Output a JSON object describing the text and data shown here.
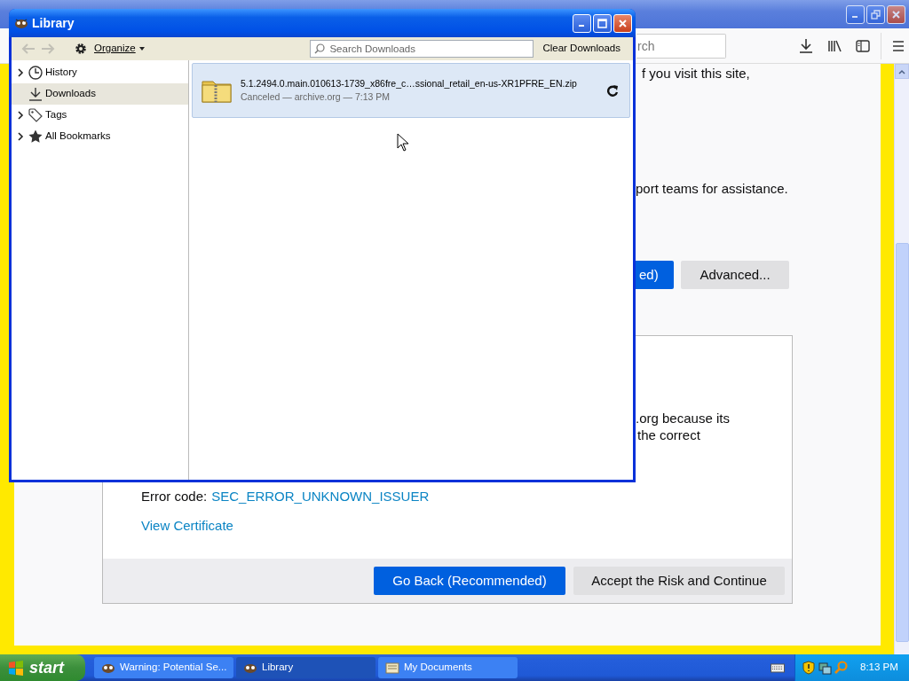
{
  "browser": {
    "search_placeholder": "rch",
    "page": {
      "intro_fragment": "f you visit this site,",
      "support_fragment": "port teams for assistance.",
      "buttons": [
        {
          "label": "ed)",
          "kind": "primary"
        },
        {
          "label": "Advanced...",
          "kind": "secondary"
        }
      ],
      "details_lines": [
        ".org because its",
        "the correct"
      ],
      "error_label": "Error code:",
      "error_code": "SEC_ERROR_UNKNOWN_ISSUER",
      "certificate_link": "View Certificate",
      "footer_buttons": [
        {
          "label": "Go Back (Recommended)",
          "kind": "primary"
        },
        {
          "label": "Accept the Risk and Continue",
          "kind": "secondary"
        }
      ]
    }
  },
  "library": {
    "title": "Library",
    "back_disabled": true,
    "forward_disabled": true,
    "organize": "Organize",
    "search_placeholder": "Search Downloads",
    "clear_button": "Clear Downloads",
    "sidebar": [
      {
        "label": "History",
        "kind": "history",
        "has_children": true,
        "selected": false
      },
      {
        "label": "Downloads",
        "kind": "downloads",
        "has_children": false,
        "selected": true
      },
      {
        "label": "Tags",
        "kind": "tags",
        "has_children": true,
        "selected": false
      },
      {
        "label": "All Bookmarks",
        "kind": "bookmarks",
        "has_children": true,
        "selected": false
      }
    ],
    "downloads": [
      {
        "name": "5.1.2494.0.main.010613-1739_x86fre_c…ssional_retail_en-us-XR1PFRE_EN.zip",
        "status": "Canceled — archive.org — 7:13 PM",
        "selected": true
      }
    ]
  },
  "taskbar": {
    "start": "start",
    "tasks": [
      {
        "label": "Warning: Potential Se...",
        "kind": "browser",
        "selected": false
      },
      {
        "label": "Library",
        "kind": "browser",
        "selected": true
      },
      {
        "label": "My Documents",
        "kind": "folder",
        "selected": false
      }
    ],
    "clock": "8:13 PM"
  }
}
